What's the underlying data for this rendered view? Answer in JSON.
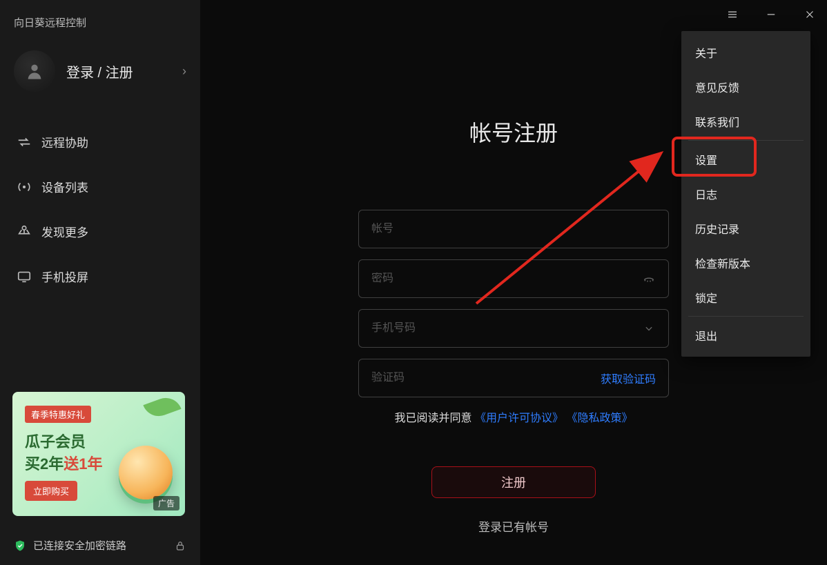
{
  "app_title": "向日葵远程控制",
  "sidebar": {
    "login_label": "登录 / 注册",
    "nav": [
      {
        "label": "远程协助"
      },
      {
        "label": "设备列表"
      },
      {
        "label": "发现更多"
      },
      {
        "label": "手机投屏"
      }
    ],
    "promo": {
      "tag": "春季特惠好礼",
      "line1": "瓜子会员",
      "line2_prefix": "买2年",
      "line2_suffix": "送1年",
      "button": "立即购买",
      "ad_label": "广告"
    },
    "status": "已连接安全加密链路"
  },
  "titlebar": {
    "menu_tooltip": "菜单",
    "min_tooltip": "最小化",
    "close_tooltip": "关闭"
  },
  "menu": {
    "items": [
      "关于",
      "意见反馈",
      "联系我们",
      "设置",
      "日志",
      "历史记录",
      "检查新版本",
      "锁定",
      "退出"
    ],
    "highlighted_index": 3
  },
  "form": {
    "title": "帐号注册",
    "account_placeholder": "帐号",
    "password_placeholder": "密码",
    "phone_placeholder": "手机号码",
    "code_placeholder": "验证码",
    "get_code_label": "获取验证码",
    "agree_prefix": "我已阅读并同意 ",
    "agree_link1": "《用户许可协议》",
    "agree_link2": "《隐私政策》",
    "register_button": "注册",
    "login_link": "登录已有帐号"
  }
}
